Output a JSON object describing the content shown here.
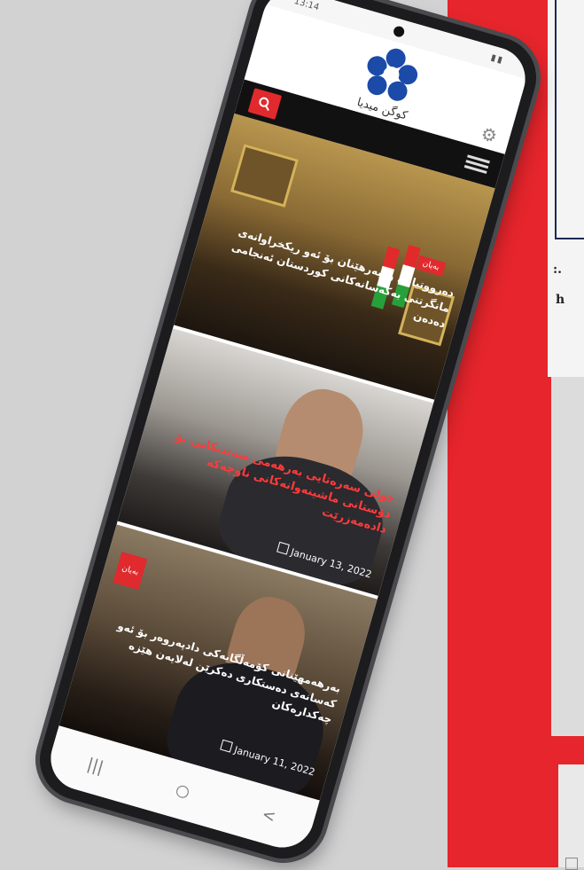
{
  "background": {
    "fragment_1": ":.",
    "fragment_2": "h",
    "accent_red": "#e6252c"
  },
  "phone": {
    "status_bar": {
      "time": "13:14",
      "icons": "▮▮"
    },
    "header": {
      "logo_text": "کوگن میدیا"
    },
    "nav": {
      "search_icon": "search-icon",
      "menu_icon": "hamburger-menu-icon"
    },
    "articles": [
      {
        "badge": "بەیان",
        "headline": "دەرووتیانی وەبەرهێنان بۆ ئەو ریکخراوانەی مانگرتنی بەکەسانەکانی کوردستان ئەنجامی دەدەن"
      },
      {
        "headline": "خولی سەرەتایی بەرهەمی سەندیکایی بۆ دۆستانی ماشینەوانەکانی ناوچەکە دادەمەزرێت",
        "date": "January 13, 2022"
      },
      {
        "badge": "بەیان",
        "headline": "بەرهەمهێنانی کۆمەڵگایەکی دادپەروەر بۆ ئەو کەسانەی دەستکاری دەکرێن لەلایەن هێزە چەکدارەکان",
        "date": "January 11, 2022"
      }
    ],
    "footer": {
      "recent_icon": "|||",
      "home_icon": "○",
      "back_icon": "<"
    }
  }
}
